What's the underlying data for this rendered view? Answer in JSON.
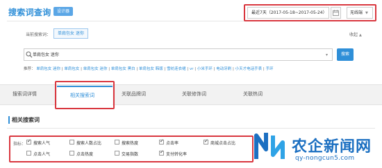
{
  "header": {
    "title": "搜索词查询",
    "badge": "设计器",
    "date_range": "最近7天（2017-05-18~2017-05-24）",
    "terminal": "无线端"
  },
  "query": {
    "current_label": "当前搜索词：",
    "current_value": "单肩包女 迷你",
    "collapse_label": "收起"
  },
  "search": {
    "value": "单肩包女 迷你",
    "button": "搜索",
    "recommend_prefix": "推荐：",
    "recommend": [
      "单肩包女 迷你",
      "单肩包女",
      "单肩包女 迷你",
      "单肩包女 黑白",
      "单肩包女 韩版",
      "雪纺连衣裙",
      "vr",
      "小米手环",
      "电动牙刷",
      "小天才电话手表",
      "手环"
    ]
  },
  "tabs": [
    "搜索词详情",
    "相关搜索词",
    "关联品牌词",
    "关联修饰词",
    "关联热词"
  ],
  "section": {
    "title": "相关搜索词"
  },
  "indicators": {
    "label": "指标：",
    "row1": [
      {
        "label": "搜索人气",
        "checked": true
      },
      {
        "label": "搜索人数占比",
        "checked": false
      },
      {
        "label": "搜索热度",
        "checked": false
      },
      {
        "label": "点击率",
        "checked": true
      },
      {
        "label": "商城点击占比",
        "checked": true
      }
    ],
    "row2": [
      {
        "label": "点击人气",
        "checked": false
      },
      {
        "label": "点击热度",
        "checked": false
      },
      {
        "label": "交易指数",
        "checked": false
      },
      {
        "label": "支付转化率",
        "checked": true
      }
    ]
  },
  "watermark": {
    "cn": "农企新闻网",
    "en": "qy-nongcun5.com"
  }
}
